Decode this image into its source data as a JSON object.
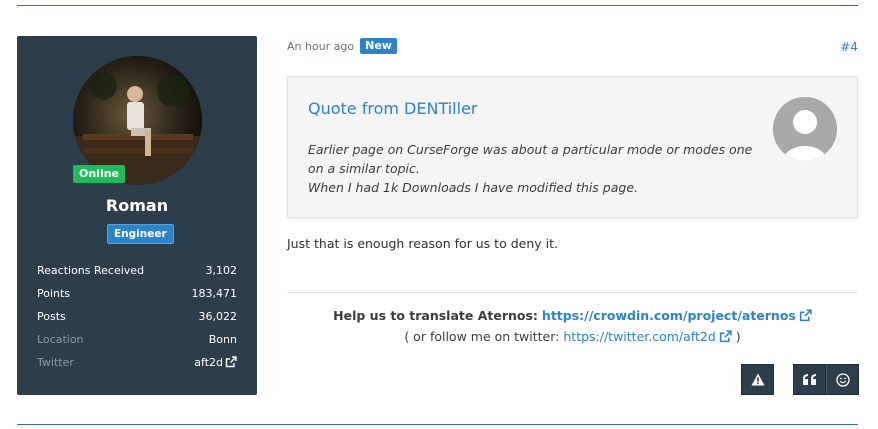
{
  "post": {
    "time": "An hour ago",
    "new_badge": "New",
    "permalink": "#4",
    "reply": "Just that is enough reason for us to deny it."
  },
  "user": {
    "status": "Online",
    "name": "Roman",
    "role": "Engineer",
    "stats": [
      {
        "label": "Reactions Received",
        "value": "3,102"
      },
      {
        "label": "Points",
        "value": "183,471"
      },
      {
        "label": "Posts",
        "value": "36,022"
      },
      {
        "label": "Location",
        "value": "Bonn"
      },
      {
        "label": "Twitter",
        "value": "aft2d"
      }
    ]
  },
  "quote": {
    "title": "Quote from DENTiller",
    "line1": "Earlier page on CurseForge was about a particular mode or modes one on a similar topic.",
    "line2": "When I had 1k Downloads I have modified this page."
  },
  "signature": {
    "prefix": "Help us to translate Aternos:",
    "crowdin_link": "https://crowdin.com/project/aternos",
    "follow_open": "( or follow me on twitter:",
    "twitter_link": "https://twitter.com/aft2d",
    "follow_close": ")"
  },
  "icons": {
    "report": "warning-icon",
    "quote": "quote-icon",
    "react": "smiley-icon",
    "external": "external-link-icon"
  },
  "colors": {
    "card_bg": "#2c3e4c",
    "accent": "#2d83c7",
    "online": "#1fba5a"
  }
}
